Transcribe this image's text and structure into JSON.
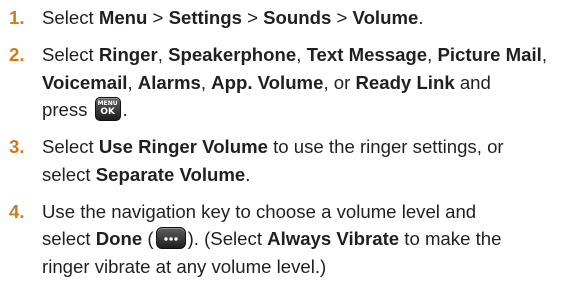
{
  "steps": [
    {
      "number": "1.",
      "parts": [
        {
          "t": "Select "
        },
        {
          "t": "Menu",
          "b": true
        },
        {
          "t": " > "
        },
        {
          "t": "Settings",
          "b": true
        },
        {
          "t": " > "
        },
        {
          "t": "Sounds",
          "b": true
        },
        {
          "t": " > "
        },
        {
          "t": "Volume",
          "b": true
        },
        {
          "t": "."
        }
      ]
    },
    {
      "number": "2.",
      "parts": [
        {
          "t": "Select "
        },
        {
          "t": "Ringer",
          "b": true
        },
        {
          "t": ", "
        },
        {
          "t": "Speakerphone",
          "b": true
        },
        {
          "t": ", "
        },
        {
          "t": "Text Message",
          "b": true
        },
        {
          "t": ", "
        },
        {
          "t": "Picture Mail",
          "b": true
        },
        {
          "t": ",",
          "br": true
        },
        {
          "t": "Voicemail",
          "b": true
        },
        {
          "t": ", "
        },
        {
          "t": "Alarms",
          "b": true
        },
        {
          "t": ", "
        },
        {
          "t": "App. Volume",
          "b": true
        },
        {
          "t": ", or "
        },
        {
          "t": "Ready Link",
          "b": true
        },
        {
          "t": " and",
          "br": true
        },
        {
          "t": "press "
        },
        {
          "icon": "menu-ok-key-icon",
          "icon_text_top": "MENU",
          "icon_text_bottom": "OK"
        },
        {
          "t": "."
        }
      ]
    },
    {
      "number": "3.",
      "parts": [
        {
          "t": "Select "
        },
        {
          "t": "Use Ringer Volume",
          "b": true
        },
        {
          "t": " to use the ringer settings, or",
          "br": true
        },
        {
          "t": "select "
        },
        {
          "t": "Separate Volume",
          "b": true
        },
        {
          "t": "."
        }
      ]
    },
    {
      "number": "4.",
      "parts": [
        {
          "t": "Use the navigation key to choose a volume level and",
          "br": true
        },
        {
          "t": "select "
        },
        {
          "t": "Done",
          "b": true
        },
        {
          "t": " ("
        },
        {
          "icon": "softkey-dots-icon"
        },
        {
          "t": "). (Select "
        },
        {
          "t": "Always Vibrate",
          "b": true
        },
        {
          "t": " to make the",
          "br": true
        },
        {
          "t": "ringer vibrate at any volume level.)"
        }
      ]
    }
  ],
  "colors": {
    "number": "#d4781c",
    "text": "#231f20"
  }
}
